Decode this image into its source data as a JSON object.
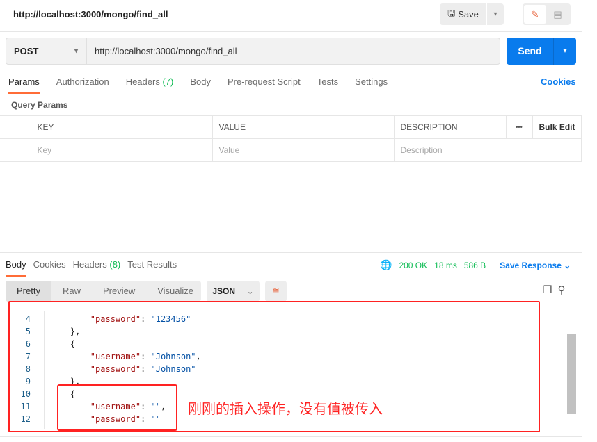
{
  "header": {
    "title": "http://localhost:3000/mongo/find_all",
    "save_label": "Save"
  },
  "request": {
    "method": "POST",
    "url": "http://localhost:3000/mongo/find_all",
    "send_label": "Send"
  },
  "tabs": [
    {
      "label": "Params"
    },
    {
      "label": "Authorization"
    },
    {
      "label": "Headers",
      "count": "(7)"
    },
    {
      "label": "Body"
    },
    {
      "label": "Pre-request Script"
    },
    {
      "label": "Tests"
    },
    {
      "label": "Settings"
    }
  ],
  "cookies_label": "Cookies",
  "query_params": {
    "title": "Query Params",
    "columns": [
      "KEY",
      "VALUE",
      "DESCRIPTION"
    ],
    "more": "•••",
    "bulk_edit": "Bulk Edit",
    "placeholders": [
      "Key",
      "Value",
      "Description"
    ]
  },
  "response": {
    "tabs": [
      {
        "label": "Body"
      },
      {
        "label": "Cookies"
      },
      {
        "label": "Headers",
        "count": "(8)"
      },
      {
        "label": "Test Results"
      }
    ],
    "status": "200 OK",
    "time": "18 ms",
    "size": "586 B",
    "save_response": "Save Response",
    "views": [
      "Pretty",
      "Raw",
      "Preview",
      "Visualize"
    ],
    "format": "JSON",
    "lines": [
      {
        "n": "4",
        "indent": "        ",
        "key": "\"password\"",
        "val": "\"123456\"",
        "tail": ""
      },
      {
        "n": "5",
        "indent": "    ",
        "raw": "},"
      },
      {
        "n": "6",
        "indent": "    ",
        "raw": "{"
      },
      {
        "n": "7",
        "indent": "        ",
        "key": "\"username\"",
        "val": "\"Johnson\"",
        "tail": ","
      },
      {
        "n": "8",
        "indent": "        ",
        "key": "\"password\"",
        "val": "\"Johnson\"",
        "tail": ""
      },
      {
        "n": "9",
        "indent": "    ",
        "raw": "},"
      },
      {
        "n": "10",
        "indent": "    ",
        "raw": "{"
      },
      {
        "n": "11",
        "indent": "        ",
        "key": "\"username\"",
        "val": "\"\"",
        "tail": ","
      },
      {
        "n": "12",
        "indent": "        ",
        "key": "\"password\"",
        "val": "\"\"",
        "tail": ""
      }
    ]
  },
  "annotation": "刚刚的插入操作，没有值被传入",
  "colors": {
    "accent": "#ff6c37",
    "primary": "#097bed",
    "annotation": "#ff2222",
    "status_ok": "#0cbb52"
  }
}
